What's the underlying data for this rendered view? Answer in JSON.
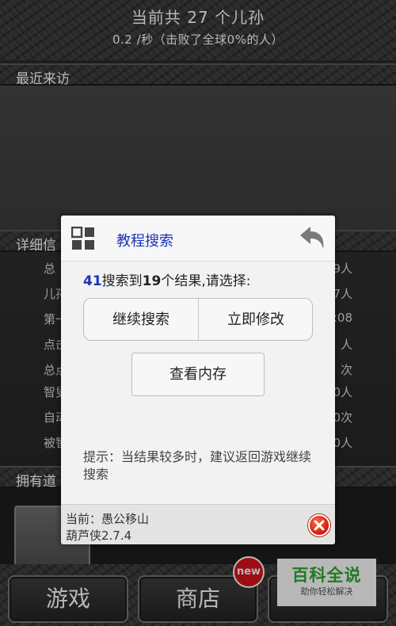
{
  "header": {
    "title": "当前共 27 个儿孙",
    "rate": "0.2 /秒（击败了全球0%的人）"
  },
  "sections": {
    "recent": "最近来访",
    "detail": "详细信",
    "items": "拥有道"
  },
  "detail_rows": [
    {
      "k": "总",
      "v": "9人"
    },
    {
      "k": "儿孙",
      "v": "7人"
    },
    {
      "k": "第一",
      "v": ":08"
    },
    {
      "k": "点击",
      "v": "人"
    },
    {
      "k": "总点",
      "v": "次"
    },
    {
      "k": "智叟",
      "v": "0人"
    },
    {
      "k": "自动",
      "v": "0次"
    },
    {
      "k": "被智",
      "v": "0人"
    }
  ],
  "bottom_nav": {
    "game": "游戏",
    "shop": "商店",
    "badge": "new"
  },
  "watermark": {
    "title": "百科全说",
    "subtitle": "助你轻松解决"
  },
  "dialog": {
    "title": "教程搜索",
    "result_count": "41",
    "result_mid": "搜索到",
    "result_num": "19",
    "result_tail": "个结果,请选择:",
    "continue_search": "继续搜索",
    "modify_now": "立即修改",
    "view_memory": "查看内存",
    "hint": "提示：当结果较多时，建议返回游戏继续搜索",
    "current": "当前：愚公移山",
    "version": "葫芦侠2.7.4"
  },
  "colors": {
    "accent_blue": "#1a33b8",
    "close_red": "#d21a08",
    "badge_red": "#d8131d",
    "watermark_green": "#2eaa33"
  },
  "icons": {
    "grid": "grid-icon",
    "back": "back-arrow-icon",
    "close": "close-icon"
  }
}
